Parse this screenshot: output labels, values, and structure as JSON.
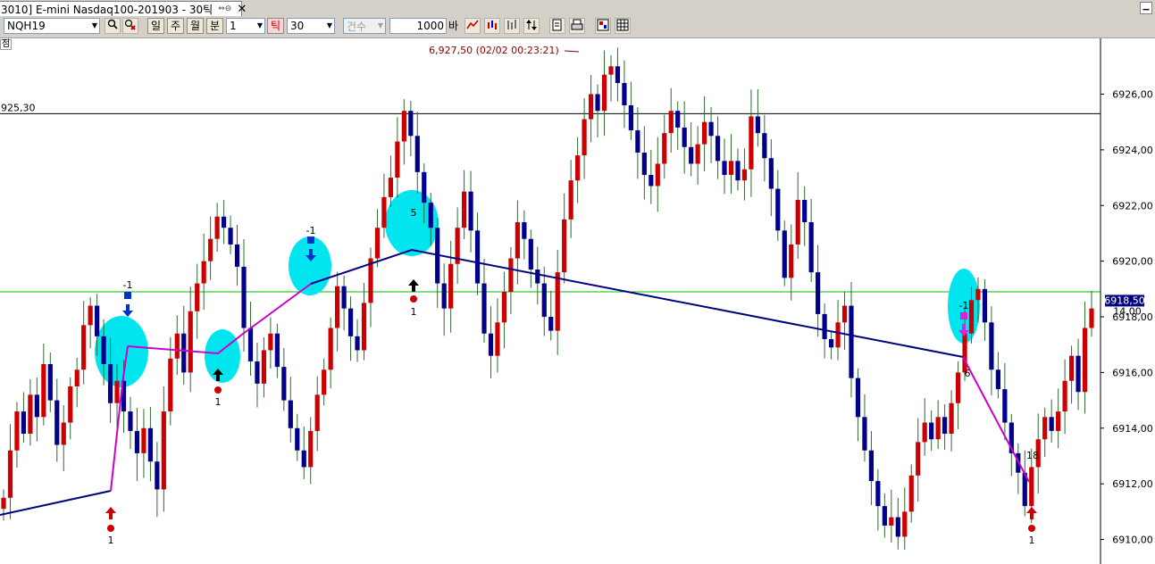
{
  "window": {
    "tab_title": "3010] E-mini Nasdaq100-201903 - 30틱",
    "tab_control_label": "⇔⊖",
    "close_label": "✕",
    "minimize_label": "▁"
  },
  "toolbar": {
    "symbol": "NQH19",
    "search_icon": "magnifier-icon",
    "period_buttons": [
      "일",
      "주",
      "월",
      "분"
    ],
    "minute_value": "1",
    "tick_button": "틱",
    "tick_value": "30",
    "count_label": "건수",
    "count_value": "1000",
    "count_unit": "바"
  },
  "corner_label": "점",
  "chart_data": {
    "type": "candlestick",
    "instrument": "E-mini Nasdaq100-201903",
    "ylim": [
      6909.2,
      6927.9
    ],
    "y_ticks": [
      "6910,00",
      "6912,00",
      "6914,00",
      "6916,00",
      "6918,00",
      "6920,00",
      "6922,00",
      "6924,00",
      "6926,00"
    ],
    "y_tick_values": [
      6910,
      6912,
      6914,
      6916,
      6918,
      6920,
      6922,
      6924,
      6926
    ],
    "current_price_label": "6918,50",
    "current_price": 6918.5,
    "price_box_sub_label": "14,00",
    "horizontal_line_black": {
      "label": "925,30",
      "value": 6925.3
    },
    "horizontal_line_green": {
      "value": 6918.9
    },
    "high_annotation": "6,927,50 (02/02 00:23:21)",
    "colors": {
      "up": "#cc0000",
      "down": "#00008b",
      "wick": "#2f6b2f",
      "zigzag_navy": "#000080",
      "zigzag_magenta": "#cc00cc",
      "highlight": "#00e5ee",
      "green_line": "#00c000",
      "price_box": "#000080",
      "annotation": "#8b0000"
    },
    "marker_labels": [
      "1",
      "-1",
      "1",
      "-1",
      "5",
      "1",
      "-1",
      "6",
      "18",
      "1"
    ],
    "close_series": [
      6911.5,
      6913.2,
      6914.6,
      6913.8,
      6915.2,
      6914.4,
      6916.3,
      6915.0,
      6913.4,
      6914.2,
      6915.5,
      6916.1,
      6917.7,
      6918.4,
      6917.3,
      6916.3,
      6914.9,
      6915.7,
      6914.6,
      6913.9,
      6913.1,
      6914.0,
      6912.8,
      6911.8,
      6914.6,
      6916.5,
      6917.4,
      6916.0,
      6918.2,
      6919.2,
      6920.0,
      6920.8,
      6921.6,
      6921.2,
      6920.6,
      6919.8,
      6917.6,
      6916.4,
      6915.6,
      6916.8,
      6917.4,
      6916.2,
      6915.0,
      6914.0,
      6913.2,
      6912.6,
      6913.9,
      6915.2,
      6916.1,
      6917.6,
      6919.1,
      6918.3,
      6917.3,
      6916.8,
      6918.5,
      6920.1,
      6921.2,
      6922.3,
      6923.0,
      6924.3,
      6925.4,
      6924.5,
      6923.2,
      6922.1,
      6921.2,
      6919.2,
      6918.3,
      6919.9,
      6921.2,
      6922.5,
      6921.1,
      6919.2,
      6917.4,
      6916.6,
      6917.8,
      6918.9,
      6920.1,
      6921.4,
      6920.8,
      6919.7,
      6919.2,
      6918.0,
      6917.5,
      6919.6,
      6921.5,
      6922.9,
      6923.8,
      6925.1,
      6926.0,
      6925.4,
      6926.7,
      6927.0,
      6926.4,
      6925.6,
      6924.7,
      6923.9,
      6923.1,
      6922.7,
      6923.5,
      6924.6,
      6925.4,
      6924.8,
      6924.1,
      6923.5,
      6924.2,
      6925.0,
      6924.5,
      6923.6,
      6923.1,
      6923.6,
      6922.9,
      6923.3,
      6925.2,
      6924.6,
      6923.7,
      6922.6,
      6921.1,
      6919.4,
      6920.6,
      6922.2,
      6921.4,
      6919.6,
      6918.1,
      6917.2,
      6916.9,
      6917.8,
      6918.4,
      6915.8,
      6914.4,
      6913.2,
      6912.1,
      6911.2,
      6910.5,
      6910.8,
      6910.1,
      6911.0,
      6912.3,
      6913.5,
      6914.2,
      6913.6,
      6914.4,
      6913.8,
      6914.9,
      6916.0,
      6917.4,
      6918.6,
      6919.0,
      6917.8,
      6916.1,
      6915.4,
      6914.2,
      6913.1,
      6912.4,
      6911.2,
      6912.6,
      6913.6,
      6914.4,
      6913.9,
      6914.6,
      6915.7,
      6916.6,
      6915.3,
      6917.6,
      6918.3
    ]
  }
}
